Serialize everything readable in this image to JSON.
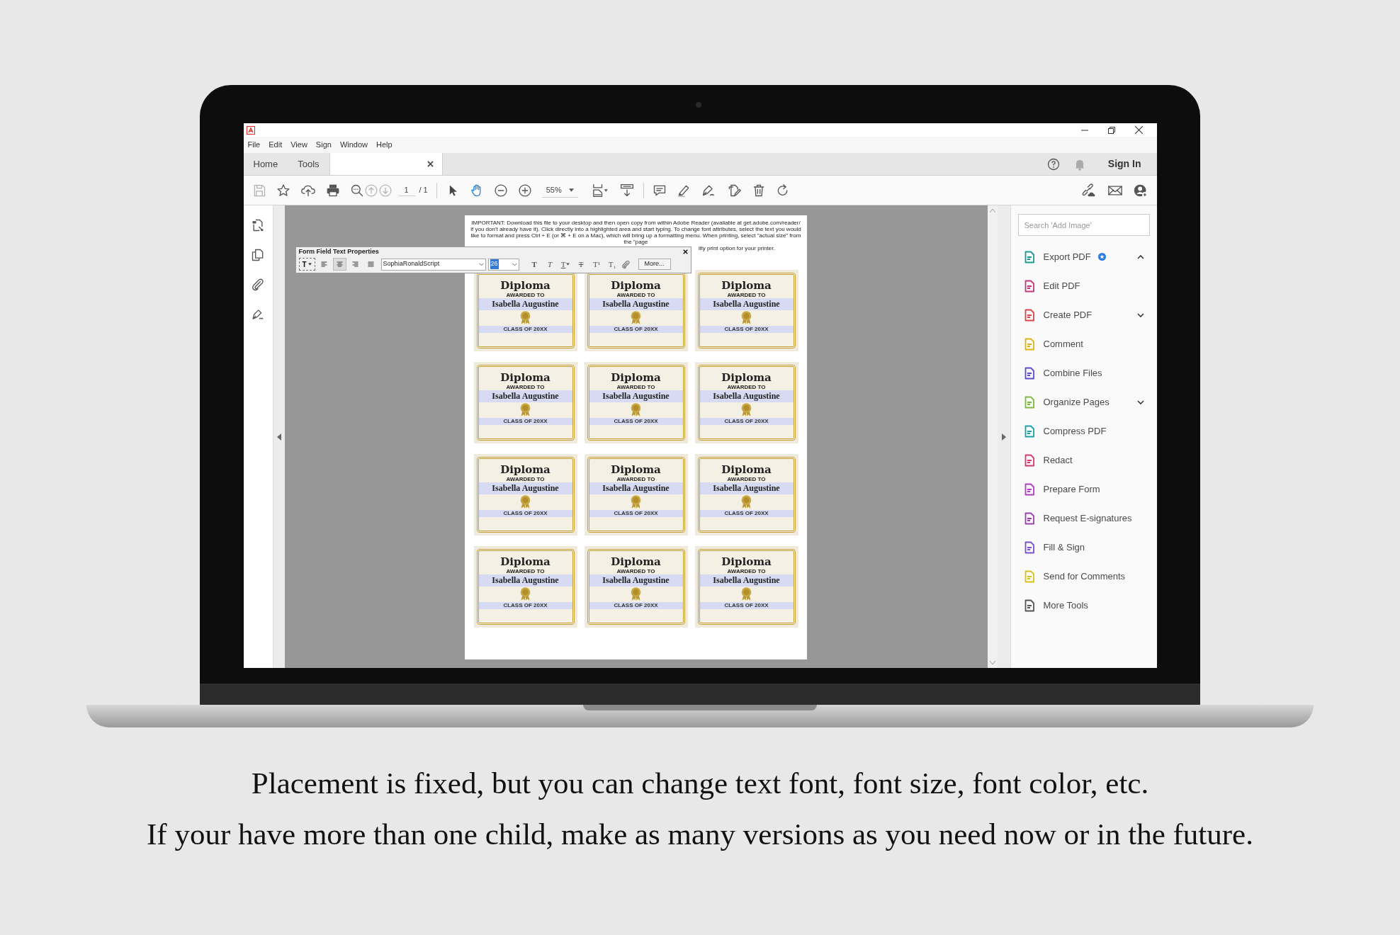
{
  "window": {
    "menu": [
      "File",
      "Edit",
      "View",
      "Sign",
      "Window",
      "Help"
    ],
    "tabs": [
      {
        "kind": "page",
        "label": "Home",
        "selected": false
      },
      {
        "kind": "page",
        "label": "Tools",
        "selected": false
      },
      {
        "kind": "document",
        "selected": true
      }
    ],
    "sign_in": "Sign In"
  },
  "toolbar": {
    "page_nav": [
      {
        "kind": "previous",
        "disabled": true
      },
      {
        "kind": "next",
        "disabled": true
      }
    ],
    "page_number": "1",
    "page_count": "/ 1",
    "pointer_tools": [
      {
        "kind": "select",
        "selected": false
      },
      {
        "kind": "hand",
        "selected": true
      }
    ],
    "zoom": "55%"
  },
  "document": {
    "notice_lines": [
      "IMPORTANT: Download this file to your desktop and then open copy from within Adobe Reader (available at get.adobe.com/reader/ if you",
      "don't already have it). Click directly into a highlighted area and start typing. To change font attributes, select the text you would like to",
      "format and press Ctrl + E (or ⌘ + E on a Mac), which will bring up a formatting menu. When printing, select \"actual size\" from the \"page",
      "lity print option for your printer."
    ],
    "diplomas": [
      {
        "title": "Diploma",
        "awarded": "AWARDED TO",
        "name": "Isabella Augustine",
        "class": "CLASS OF 20XX"
      },
      {
        "title": "Diploma",
        "awarded": "AWARDED TO",
        "name": "Isabella Augustine",
        "class": "CLASS OF 20XX"
      },
      {
        "title": "Diploma",
        "awarded": "AWARDED TO",
        "name": "Isabella Augustine",
        "class": "CLASS OF 20XX"
      },
      {
        "title": "Diploma",
        "awarded": "AWARDED TO",
        "name": "Isabella Augustine",
        "class": "CLASS OF 20XX"
      },
      {
        "title": "Diploma",
        "awarded": "AWARDED TO",
        "name": "Isabella Augustine",
        "class": "CLASS OF 20XX"
      },
      {
        "title": "Diploma",
        "awarded": "AWARDED TO",
        "name": "Isabella Augustine",
        "class": "CLASS OF 20XX"
      },
      {
        "title": "Diploma",
        "awarded": "AWARDED TO",
        "name": "Isabella Augustine",
        "class": "CLASS OF 20XX"
      },
      {
        "title": "Diploma",
        "awarded": "AWARDED TO",
        "name": "Isabella Augustine",
        "class": "CLASS OF 20XX"
      },
      {
        "title": "Diploma",
        "awarded": "AWARDED TO",
        "name": "Isabella Augustine",
        "class": "CLASS OF 20XX"
      },
      {
        "title": "Diploma",
        "awarded": "AWARDED TO",
        "name": "Isabella Augustine",
        "class": "CLASS OF 20XX"
      },
      {
        "title": "Diploma",
        "awarded": "AWARDED TO",
        "name": "Isabella Augustine",
        "class": "CLASS OF 20XX"
      },
      {
        "title": "Diploma",
        "awarded": "AWARDED TO",
        "name": "Isabella Augustine",
        "class": "CLASS OF 20XX"
      }
    ]
  },
  "form_panel": {
    "title": "Form Field Text Properties",
    "color_button": "T",
    "alignments": [
      {
        "kind": "left",
        "selected": false
      },
      {
        "kind": "center",
        "selected": true
      },
      {
        "kind": "right",
        "selected": false
      },
      {
        "kind": "justify",
        "selected": false
      }
    ],
    "font": "SophiaRonaldScript",
    "size": "26",
    "format_buttons": [
      {
        "kind": "bold",
        "label": "T"
      },
      {
        "kind": "italic",
        "label": "T"
      },
      {
        "kind": "underline",
        "label": "T"
      },
      {
        "kind": "strike",
        "label": "T"
      },
      {
        "kind": "superscript",
        "label": "T¹"
      },
      {
        "kind": "subscript",
        "label": "T₁"
      }
    ],
    "more": "More..."
  },
  "tools_panel": {
    "search": {
      "placeholder": "Search 'Add Image'"
    },
    "tools": [
      {
        "label": "Export PDF",
        "color": "#1a9a8f",
        "badge": true,
        "expanded": true
      },
      {
        "label": "Edit PDF",
        "color": "#c2387b",
        "badge": false
      },
      {
        "label": "Create PDF",
        "color": "#d9434a",
        "badge": false,
        "expanded": false
      },
      {
        "label": "Comment",
        "color": "#e0b315",
        "badge": false
      },
      {
        "label": "Combine Files",
        "color": "#5a4fd4",
        "badge": false
      },
      {
        "label": "Organize Pages",
        "color": "#7dbb3d",
        "badge": false,
        "expanded": false
      },
      {
        "label": "Compress PDF",
        "color": "#1aa0a8",
        "badge": false
      },
      {
        "label": "Redact",
        "color": "#d6376d",
        "badge": false
      },
      {
        "label": "Prepare Form",
        "color": "#b43cc4",
        "badge": false
      },
      {
        "label": "Request E-signatures",
        "color": "#9b3fb0",
        "badge": false
      },
      {
        "label": "Fill & Sign",
        "color": "#7a4fd0",
        "badge": false
      },
      {
        "label": "Send for Comments",
        "color": "#d8c21a",
        "badge": false
      },
      {
        "label": "More Tools",
        "color": "#555555",
        "badge": false
      }
    ]
  },
  "caption": [
    "Placement is fixed, but you can change text font, font size, font color, etc.",
    "If your have more than one child, make as many versions as you need now or in the future."
  ]
}
